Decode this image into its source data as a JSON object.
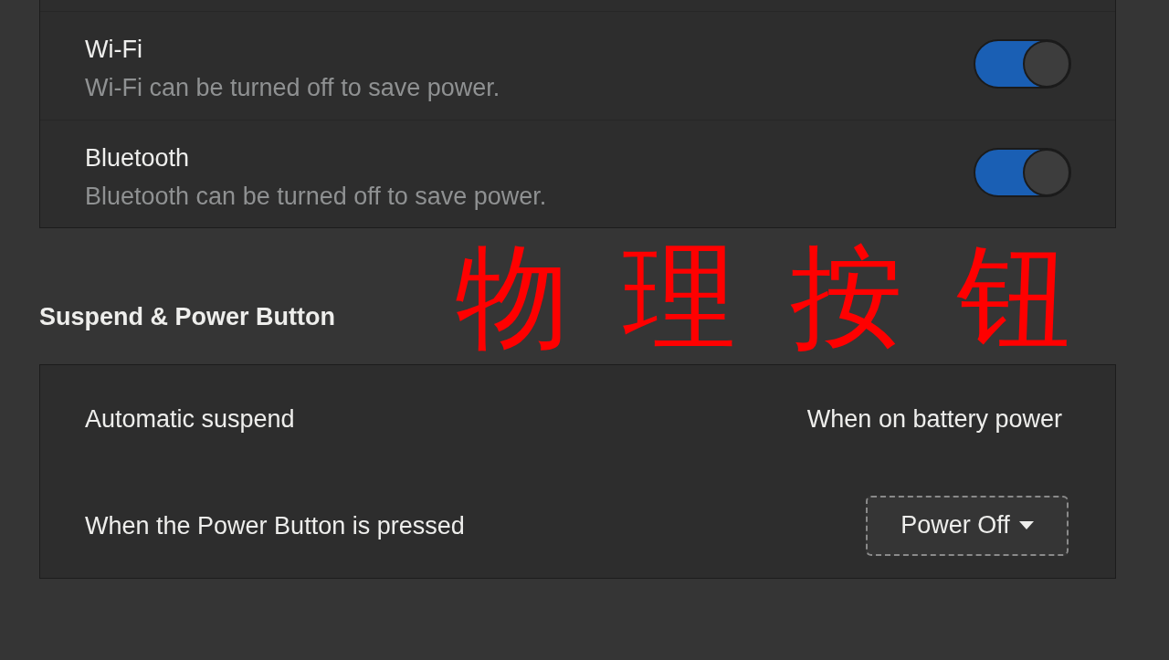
{
  "power_saving_panel": {
    "rows": [
      {
        "kind": "switch",
        "title": "Wi-Fi",
        "subtitle": "Wi-Fi can be turned off to save power.",
        "on": true
      },
      {
        "kind": "switch",
        "title": "Bluetooth",
        "subtitle": "Bluetooth can be turned off to save power.",
        "on": true
      }
    ]
  },
  "suspend_section": {
    "heading": "Suspend & Power Button",
    "annotation": "物 理 按 钮",
    "rows": [
      {
        "kind": "value",
        "label": "Automatic suspend",
        "value": "When on battery power"
      },
      {
        "kind": "dropdown",
        "label": "When the Power Button is pressed",
        "value": "Power Off",
        "focused": true
      }
    ]
  }
}
